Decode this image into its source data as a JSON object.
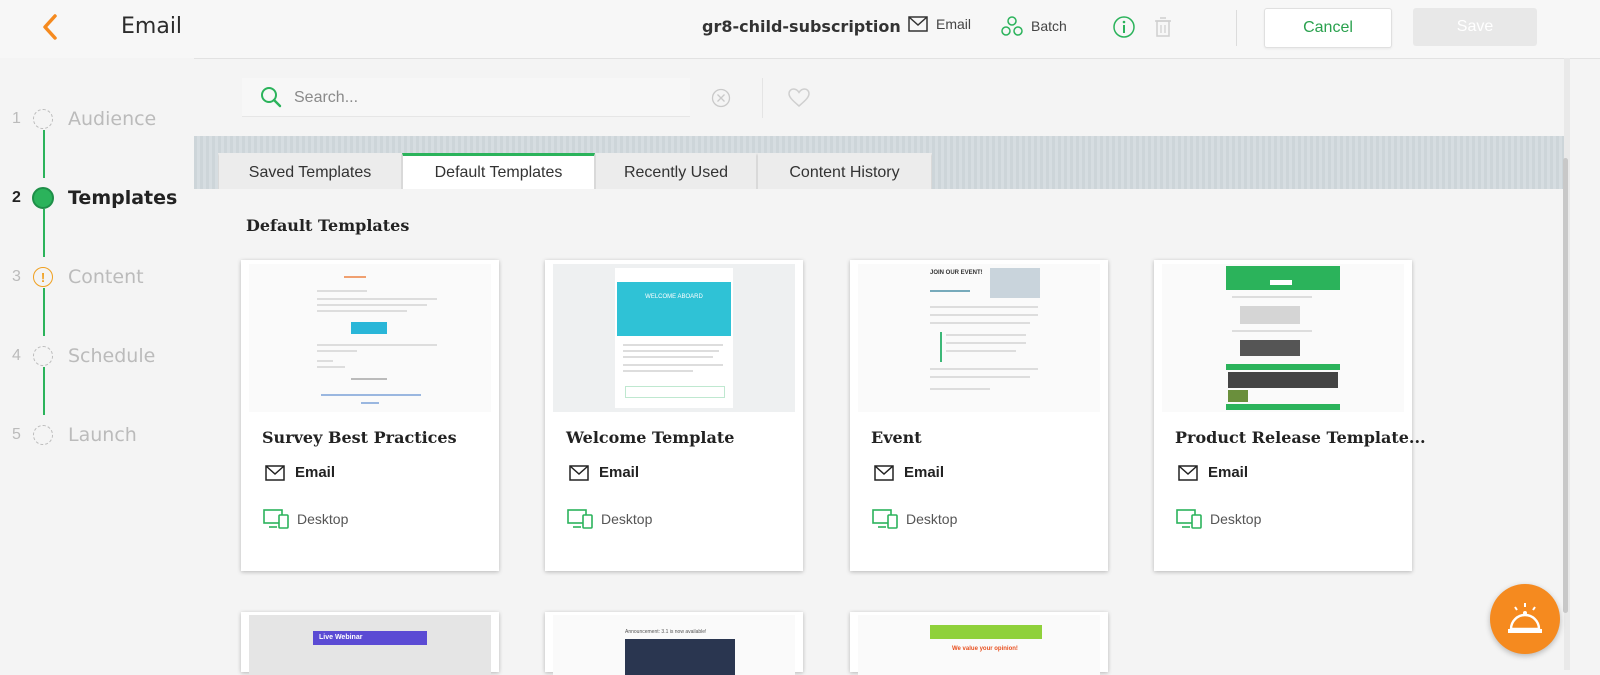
{
  "header": {
    "title": "Email",
    "subscription_name": "gr8-child-subscription",
    "channel_email_label": "Email",
    "channel_batch_label": "Batch",
    "cancel_label": "Cancel",
    "save_label": "Save"
  },
  "steps": [
    {
      "num": "1",
      "label": "Audience",
      "state": "pending"
    },
    {
      "num": "2",
      "label": "Templates",
      "state": "active"
    },
    {
      "num": "3",
      "label": "Content",
      "state": "warning",
      "glyph": "!"
    },
    {
      "num": "4",
      "label": "Schedule",
      "state": "pending"
    },
    {
      "num": "5",
      "label": "Launch",
      "state": "pending"
    }
  ],
  "search": {
    "placeholder": "Search...",
    "value": ""
  },
  "tabs": [
    {
      "label": "Saved Templates",
      "active": false
    },
    {
      "label": "Default Templates",
      "active": true
    },
    {
      "label": "Recently Used",
      "active": false
    },
    {
      "label": "Content History",
      "active": false
    }
  ],
  "section_title": "Default Templates",
  "templates": [
    {
      "name": "Survey Best Practices",
      "channel": "Email",
      "device": "Desktop"
    },
    {
      "name": "Welcome Template",
      "channel": "Email",
      "device": "Desktop"
    },
    {
      "name": "Event",
      "channel": "Email",
      "device": "Desktop"
    },
    {
      "name": "Product Release Template...",
      "channel": "Email",
      "device": "Desktop"
    }
  ],
  "thumb_text": {
    "welcome_heading": "WELCOME ABOARD",
    "event_heading": "JOIN OUR EVENT!",
    "live_webinar": "Live Webinar",
    "values_opinion": "We value your opinion!",
    "announcement": "Announcement: 3.1 is now available!"
  },
  "colors": {
    "accent_green": "#2bb35b",
    "warning_orange": "#f0a020",
    "help_orange": "#f58a1f",
    "back_arrow_orange": "#f58a1f"
  }
}
